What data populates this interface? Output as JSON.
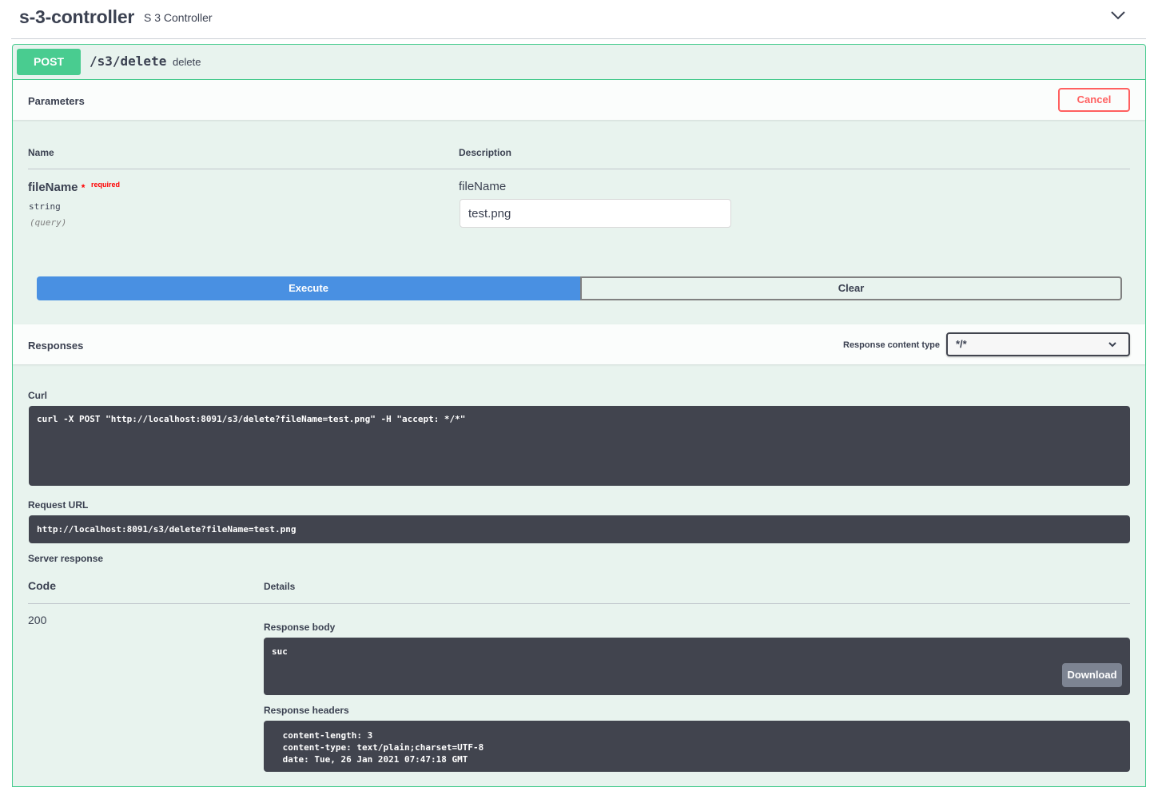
{
  "controller": {
    "name": "s-3-controller",
    "description": "S 3 Controller",
    "toggle_icon": "chevron-down-icon"
  },
  "operation": {
    "method": "POST",
    "path": "/s3/delete",
    "summary": "delete",
    "color": "#49cc90"
  },
  "parameters": {
    "title": "Parameters",
    "cancel_label": "Cancel",
    "col_name": "Name",
    "col_description": "Description",
    "items": [
      {
        "name": "fileName",
        "required_star": "*",
        "required_label": "required",
        "type": "string",
        "in": "(query)",
        "description": "fileName",
        "value": "test.png"
      }
    ]
  },
  "actions": {
    "execute_label": "Execute",
    "clear_label": "Clear",
    "execute_color": "#4990e2"
  },
  "responses": {
    "title": "Responses",
    "content_type_label": "Response content type",
    "content_type_value": "*/*"
  },
  "curl": {
    "label": "Curl",
    "command": "curl -X POST \"http://localhost:8091/s3/delete?fileName=test.png\" -H \"accept: */*\""
  },
  "request_url": {
    "label": "Request URL",
    "value": "http://localhost:8091/s3/delete?fileName=test.png"
  },
  "server_response": {
    "label": "Server response",
    "col_code": "Code",
    "col_details": "Details",
    "code": "200",
    "body_label": "Response body",
    "body": "suc",
    "download_label": "Download",
    "headers_label": "Response headers",
    "headers": " content-length: 3 \n content-type: text/plain;charset=UTF-8 \n date: Tue, 26 Jan 2021 07:47:18 GMT "
  }
}
